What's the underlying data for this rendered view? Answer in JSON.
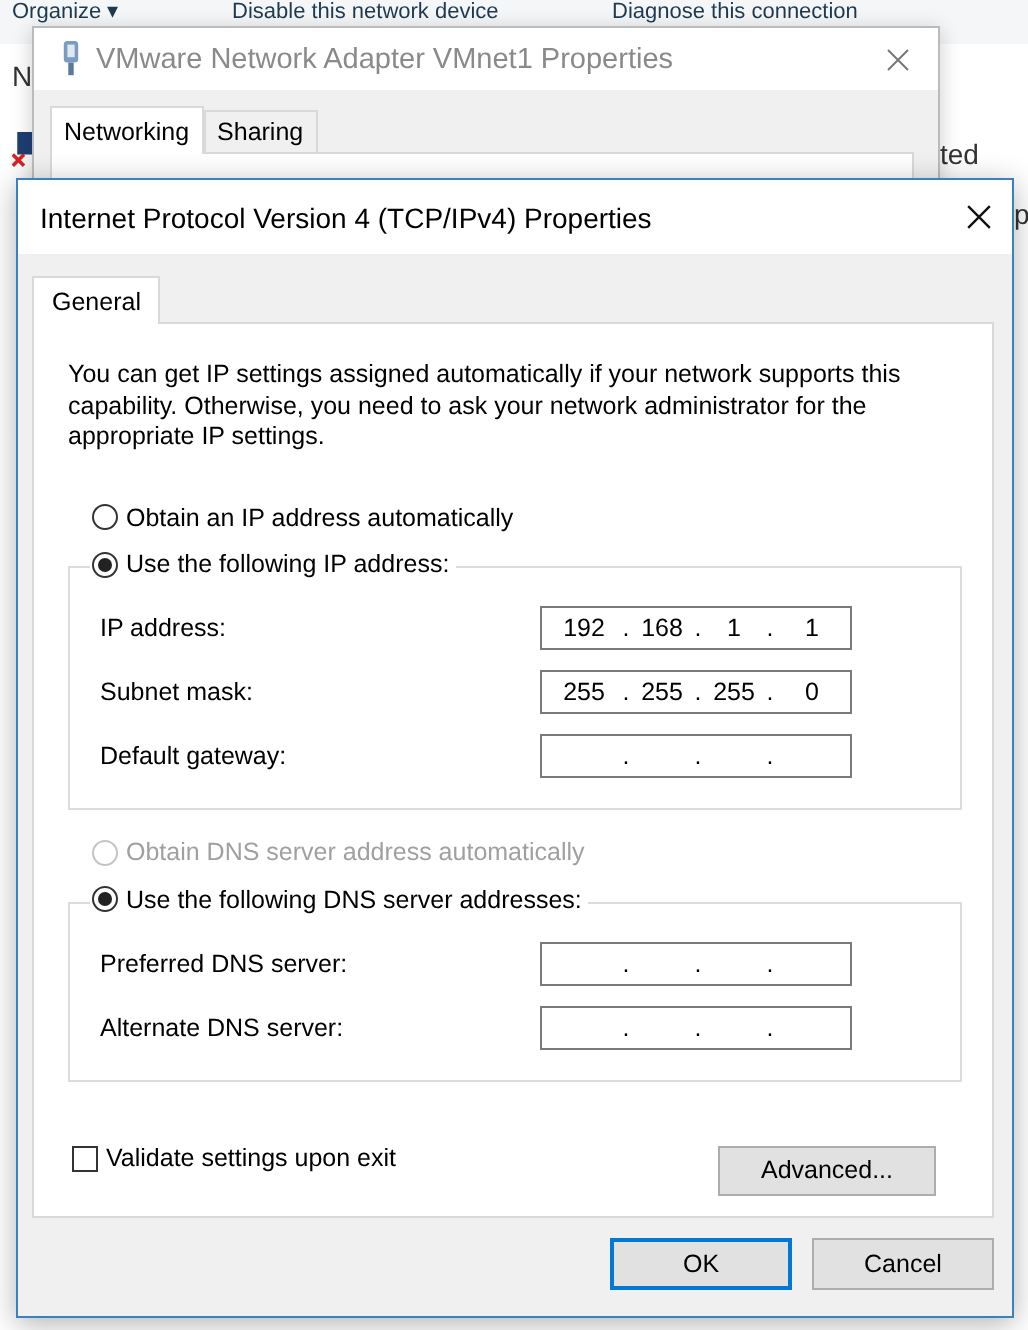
{
  "background_window": {
    "toolbar": [
      "Organize ▾",
      "Disable this network device",
      "Diagnose this connection"
    ],
    "fragments": [
      "N",
      "ted",
      "p"
    ]
  },
  "adapter_dialog": {
    "title": "VMware Network Adapter VMnet1 Properties",
    "tabs": [
      {
        "label": "Networking",
        "selected": true
      },
      {
        "label": "Sharing",
        "selected": false
      }
    ]
  },
  "ipv4_dialog": {
    "title": "Internet Protocol Version 4 (TCP/IPv4) Properties",
    "tabs": [
      {
        "label": "General",
        "selected": true
      }
    ],
    "description": "You can get IP settings assigned automatically if your network supports this capability. Otherwise, you need to ask your network administrator for the appropriate IP settings.",
    "separator": ".",
    "ip_mode": [
      {
        "label": "Obtain an IP address automatically",
        "selected": false,
        "disabled": false
      },
      {
        "label": "Use the following IP address:",
        "selected": true,
        "disabled": false
      }
    ],
    "ip_fields": [
      {
        "label": "IP address:",
        "octets": [
          "192",
          "168",
          "1",
          "1"
        ]
      },
      {
        "label": "Subnet mask:",
        "octets": [
          "255",
          "255",
          "255",
          "0"
        ]
      },
      {
        "label": "Default gateway:"
      }
    ],
    "dns_mode": [
      {
        "label": "Obtain DNS server address automatically",
        "selected": false,
        "disabled": true
      },
      {
        "label": "Use the following DNS server addresses:",
        "selected": true,
        "disabled": false
      }
    ],
    "dns_fields": [
      {
        "label": "Preferred DNS server:"
      },
      {
        "label": "Alternate DNS server:"
      }
    ],
    "validate": {
      "label": "Validate settings upon exit",
      "checked": false
    },
    "advanced_button": "Advanced...",
    "buttons": [
      {
        "label": "OK",
        "default": true
      },
      {
        "label": "Cancel",
        "default": false
      }
    ]
  }
}
